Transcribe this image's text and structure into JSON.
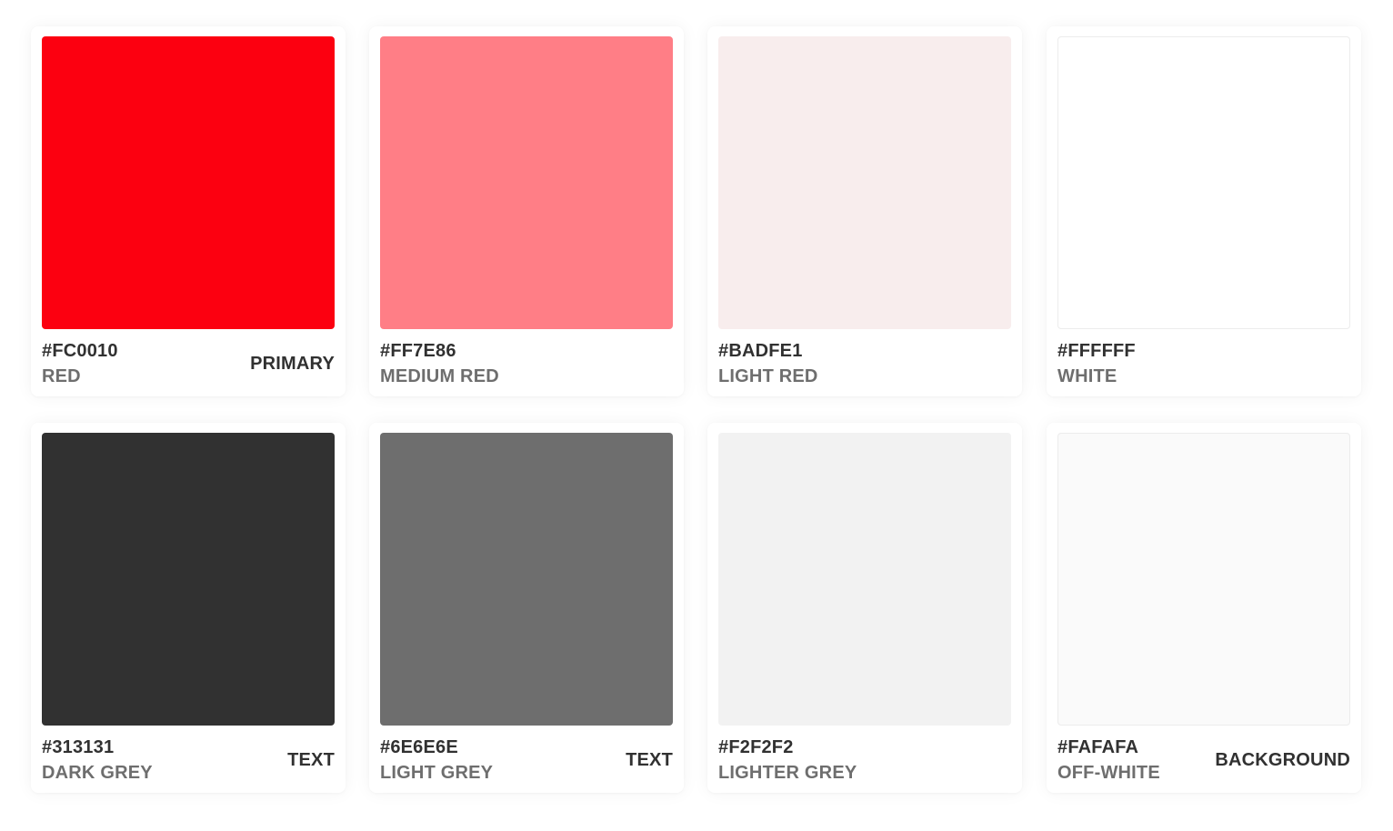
{
  "swatches": [
    {
      "hex": "#FC0010",
      "name": "RED",
      "role": "PRIMARY",
      "color": "#FC0010"
    },
    {
      "hex": "#FF7E86",
      "name": "MEDIUM RED",
      "role": "",
      "color": "#FF7E86"
    },
    {
      "hex": "#BADFE1",
      "name": "LIGHT RED",
      "role": "",
      "color": "#F8EDED"
    },
    {
      "hex": "#FFFFFF",
      "name": "WHITE",
      "role": "",
      "color": "#FFFFFF"
    },
    {
      "hex": "#313131",
      "name": "DARK GREY",
      "role": "TEXT",
      "color": "#313131"
    },
    {
      "hex": "#6E6E6E",
      "name": "LIGHT GREY",
      "role": "TEXT",
      "color": "#6E6E6E"
    },
    {
      "hex": "#F2F2F2",
      "name": "LIGHTER GREY",
      "role": "",
      "color": "#F2F2F2"
    },
    {
      "hex": "#FAFAFA",
      "name": "OFF-WHITE",
      "role": "BACKGROUND",
      "color": "#FAFAFA"
    }
  ]
}
